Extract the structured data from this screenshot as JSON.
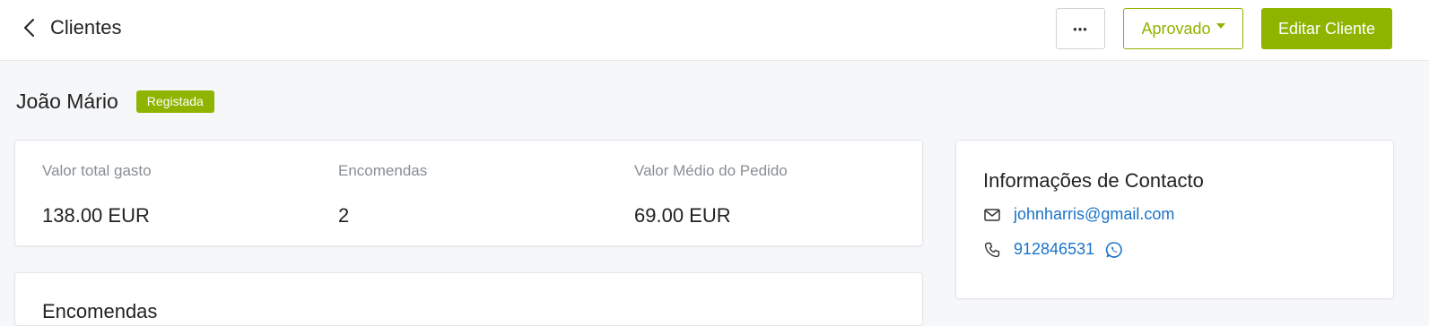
{
  "header": {
    "back_label": "Clientes",
    "more_label": "•••",
    "status_label": "Aprovado",
    "edit_label": "Editar Cliente"
  },
  "customer": {
    "name": "João Mário",
    "badge": "Registada"
  },
  "stats": [
    {
      "label": "Valor total gasto",
      "value": "138.00 EUR"
    },
    {
      "label": "Encomendas",
      "value": "2"
    },
    {
      "label": "Valor Médio do Pedido",
      "value": "69.00 EUR"
    }
  ],
  "orders": {
    "title": "Encomendas"
  },
  "contact": {
    "title": "Informações de Contacto",
    "email": "johnharris@gmail.com",
    "phone": "912846531"
  },
  "colors": {
    "accent": "#8fb400",
    "link": "#1a73c8",
    "background": "#f6f7f9"
  },
  "icons": [
    "chevron-left-icon",
    "ellipsis-icon",
    "caret-down-icon",
    "envelope-icon",
    "phone-icon",
    "whatsapp-icon"
  ]
}
